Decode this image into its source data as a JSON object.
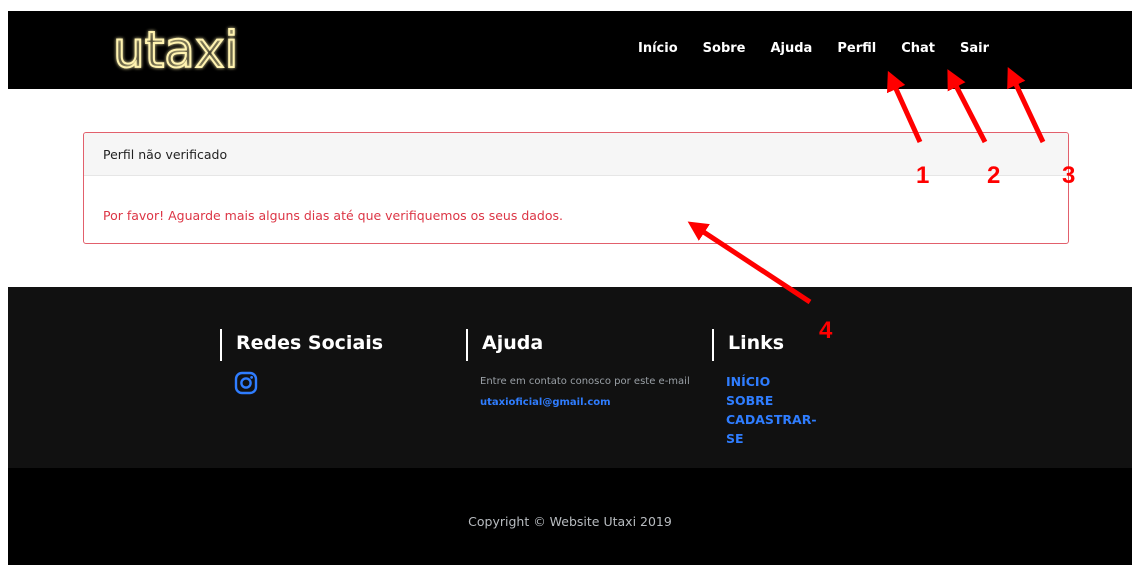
{
  "nav": {
    "logo_text": "utaxi",
    "links": [
      "Início",
      "Sobre",
      "Ajuda",
      "Perfil",
      "Chat",
      "Sair"
    ]
  },
  "card": {
    "title": "Perfil não verificado",
    "message": "Por favor! Aguarde mais alguns dias até que verifiquemos os seus dados."
  },
  "footer": {
    "social": {
      "heading": "Redes Sociais",
      "icon": "instagram-icon"
    },
    "help": {
      "heading": "Ajuda",
      "text_before": "Entre em contato conosco por este e-mail",
      "email": "utaxioficial@gmail.com"
    },
    "links": {
      "heading": "Links",
      "items": [
        "INÍCIO",
        "SOBRE",
        "CADASTRAR-SE"
      ]
    },
    "copyright": "Copyright © Website Utaxi 2019"
  },
  "annotations": {
    "labels": [
      "1",
      "2",
      "3",
      "4"
    ],
    "color": "#ff0000"
  },
  "colors": {
    "nav_bg": "#000000",
    "footer_bg": "#111111",
    "danger": "#dc3545",
    "link_blue": "#2f7dff",
    "logo_glow": "#fff3b0"
  }
}
